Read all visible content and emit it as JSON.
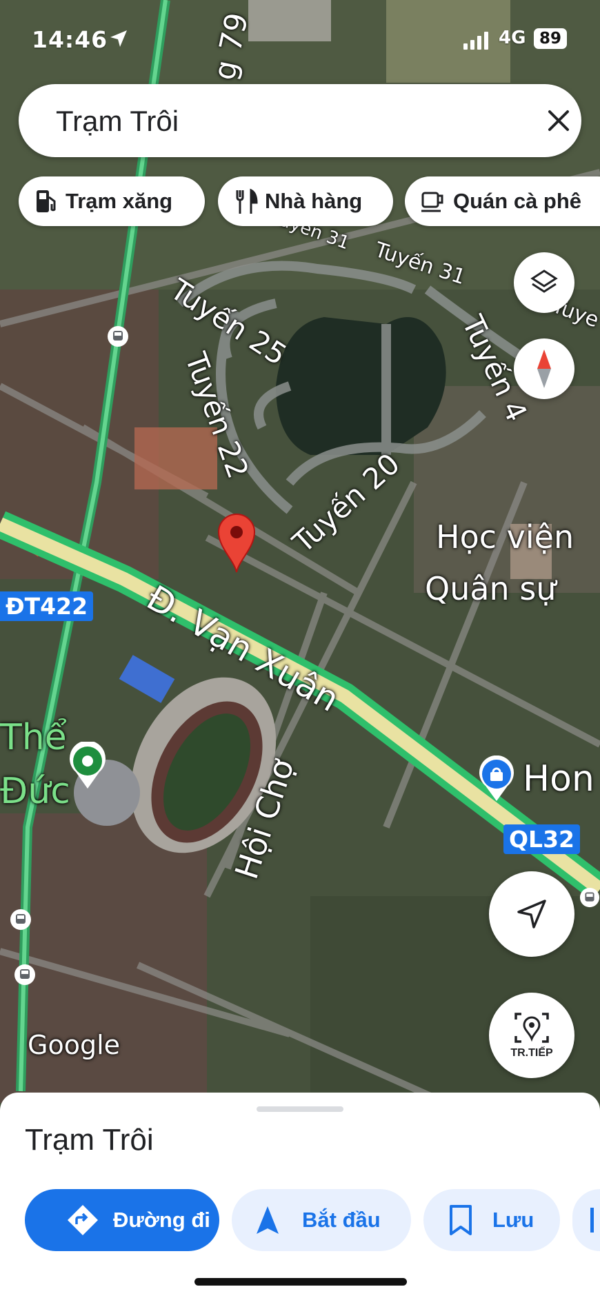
{
  "status_bar": {
    "time": "14:46",
    "network": "4G",
    "battery": "89"
  },
  "search": {
    "query": "Trạm Trôi"
  },
  "chips": [
    {
      "label": "Trạm xăng",
      "icon": "gas-station-icon"
    },
    {
      "label": "Nhà hàng",
      "icon": "restaurant-icon"
    },
    {
      "label": "Quán cà phê",
      "icon": "coffee-icon"
    }
  ],
  "map": {
    "labels": {
      "road_79": "g 79",
      "tuyen31a": "Tuyến 31",
      "tuyen31b": "Tuyến 31",
      "tuyen25": "Tuyến 25",
      "tuyen22": "Tuyến 22",
      "tuyen20": "Tuyến 20",
      "tuyen4": "Tuyến 4",
      "tuye_cut": "Tuye",
      "hoc_vien_1": "Học viện",
      "hoc_vien_2": "Quân sự",
      "van_xuan": "Đ. Vạn Xuân",
      "hoi_cho": "Hội Chợ",
      "the_duc_1": "Thể",
      "the_duc_2": "Đức",
      "hon": "Hon",
      "google": "Google"
    },
    "shields": {
      "dt422": "ĐT422",
      "ql32": "QL32"
    },
    "live_view_label": "TR.TIẾP"
  },
  "sheet": {
    "title": "Trạm Trôi",
    "directions_label": "Đường đi",
    "start_label": "Bắt đầu",
    "save_label": "Lưu"
  },
  "colors": {
    "accent": "#1a73e8",
    "route_green": "#3ddc84",
    "pin_red": "#ea4335"
  }
}
